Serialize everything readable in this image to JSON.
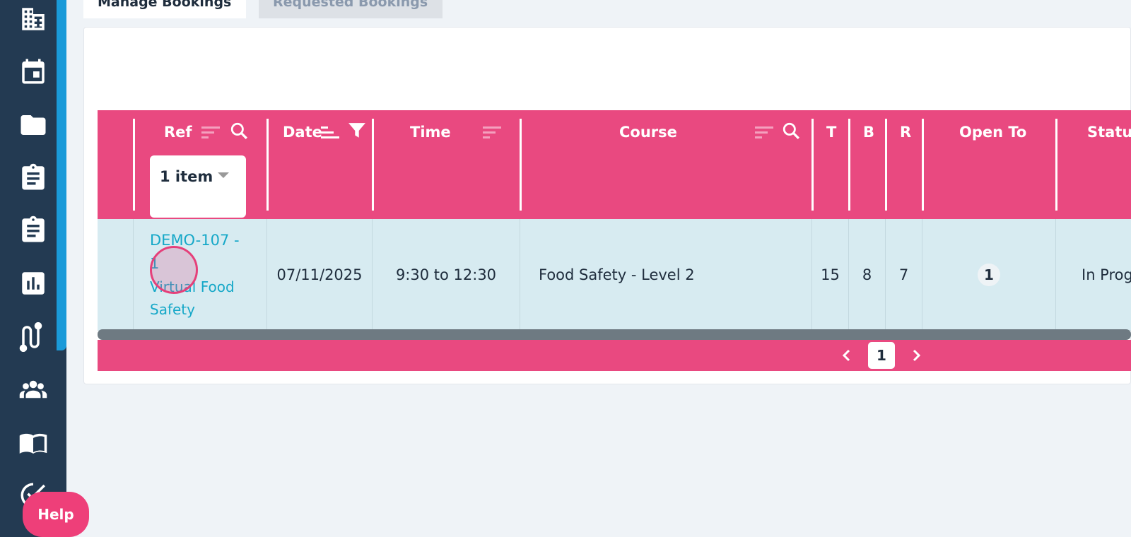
{
  "tabs": [
    {
      "label": "Manage Bookings"
    },
    {
      "label": "Requested Bookings"
    }
  ],
  "sidebar": {
    "icons": [
      "building-icon",
      "calendar-icon",
      "folder-icon",
      "clipboard-icon",
      "clipboard-list-icon",
      "bar-chart-icon",
      "route-icon",
      "users-icon",
      "book-icon",
      "check-circle-icon"
    ]
  },
  "grid": {
    "columns": [
      {
        "key": "ref",
        "label": "Ref"
      },
      {
        "key": "date",
        "label": "Date"
      },
      {
        "key": "time",
        "label": "Time"
      },
      {
        "key": "course",
        "label": "Course"
      },
      {
        "key": "t",
        "label": "T"
      },
      {
        "key": "b",
        "label": "B"
      },
      {
        "key": "r",
        "label": "R"
      },
      {
        "key": "open_to",
        "label": "Open To"
      },
      {
        "key": "status",
        "label": "Status"
      }
    ],
    "ref_filter": {
      "value": "1 item"
    },
    "rows": [
      {
        "ref": "DEMO-107 - 1",
        "ref_sub": "Virtual Food Safety",
        "date": "07/11/2025",
        "time": "9:30 to 12:30",
        "course": "Food Safety - Level 2",
        "t": "15",
        "b": "8",
        "r": "7",
        "open_to": "1",
        "status": "In Progress"
      }
    ],
    "pager": {
      "current_page": "1"
    }
  },
  "help": {
    "label": "Help"
  },
  "colors": {
    "accent": "#e94980",
    "sidebar": "#233a52",
    "link": "#16a8c8",
    "row": "#d7ebf1"
  }
}
